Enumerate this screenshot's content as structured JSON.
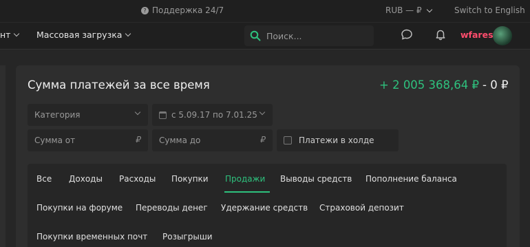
{
  "topbar": {
    "support_label": "Поддержка 24/7",
    "currency_label": "RUB — ₽",
    "language_switch": "Switch to English"
  },
  "navbar": {
    "partial_item": "нт",
    "bulk_upload": "Массовая загрузка",
    "search_placeholder": "Поиск...",
    "username": "wfares"
  },
  "panel": {
    "title": "Сумма платежей за все время",
    "total_income": "+ 2 005 368,64 ₽",
    "total_outgoing": "- 0 ₽",
    "filters": {
      "category_placeholder": "Категория",
      "date_range": "с 5.09.17 по 7.01.25",
      "amount_from_placeholder": "Сумма от",
      "amount_to_placeholder": "Сумма до",
      "currency_symbol": "₽",
      "hold_label": "Платежи в холде"
    },
    "tabs": [
      "Все",
      "Доходы",
      "Расходы",
      "Покупки",
      "Продажи",
      "Выводы средств",
      "Пополнение баланса",
      "Покупки на форуме",
      "Переводы денег",
      "Удержание средств",
      "Страховой депозит",
      "Покупки временных почт",
      "Розыгрыши"
    ],
    "active_tab": "Продажи"
  },
  "colors": {
    "accent_green": "#2ec27e",
    "username_pink": "#ff4d6d",
    "background": "#262626",
    "panel": "#2e2e2e"
  }
}
